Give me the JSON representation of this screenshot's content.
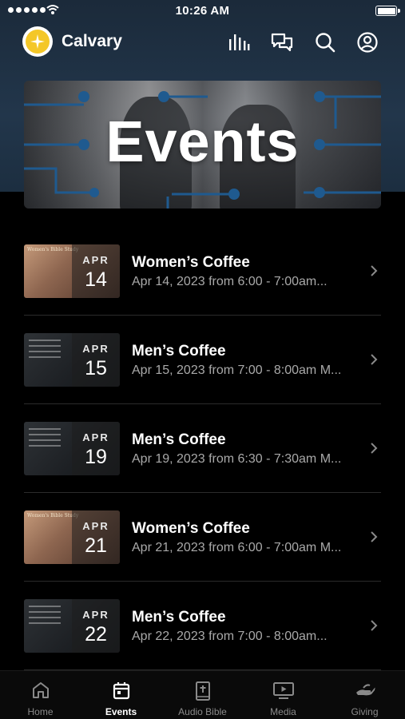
{
  "status_bar": {
    "time": "10:26 AM"
  },
  "header": {
    "app_name": "Calvary"
  },
  "hero": {
    "title": "Events"
  },
  "events": [
    {
      "thumb_text": "Women's Bible Study",
      "month": "APR",
      "day": "14",
      "title": "Women’s Coffee",
      "subtitle": "Apr 14, 2023 from 6:00 - 7:00am..."
    },
    {
      "thumb_text": "",
      "month": "APR",
      "day": "15",
      "title": "Men’s Coffee",
      "subtitle": "Apr 15, 2023 from 7:00 - 8:00am M..."
    },
    {
      "thumb_text": "",
      "month": "APR",
      "day": "19",
      "title": "Men’s Coffee",
      "subtitle": "Apr 19, 2023 from 6:30 - 7:30am M..."
    },
    {
      "thumb_text": "Women's Bible Study",
      "month": "APR",
      "day": "21",
      "title": "Women’s Coffee",
      "subtitle": "Apr 21, 2023 from 6:00 - 7:00am M..."
    },
    {
      "thumb_text": "",
      "month": "APR",
      "day": "22",
      "title": "Men’s Coffee",
      "subtitle": "Apr 22, 2023 from 7:00 - 8:00am..."
    }
  ],
  "tab_bar": {
    "tabs": [
      {
        "label": "Home",
        "icon": "home-icon",
        "active": false
      },
      {
        "label": "Events",
        "icon": "calendar-icon",
        "active": true
      },
      {
        "label": "Audio Bible",
        "icon": "bible-icon",
        "active": false
      },
      {
        "label": "Media",
        "icon": "tv-play-icon",
        "active": false
      },
      {
        "label": "Giving",
        "icon": "giving-hand-icon",
        "active": false
      }
    ]
  },
  "colors": {
    "background": "#000000",
    "header_gradient": "#22364b",
    "logo_yellow": "#f4c728",
    "hero_accent_blue": "#1f4d7a",
    "subtitle_gray": "#a9a9a9"
  }
}
